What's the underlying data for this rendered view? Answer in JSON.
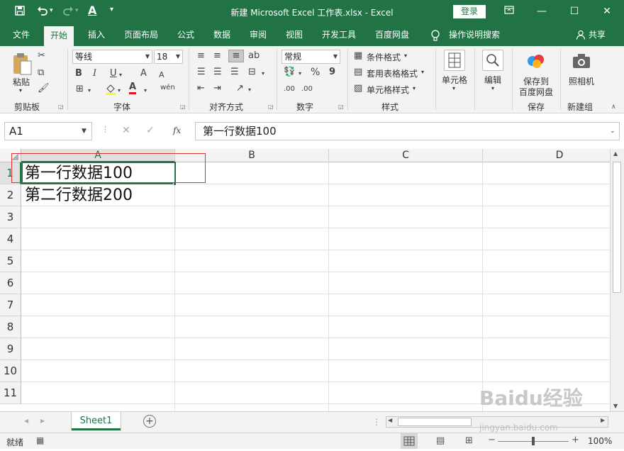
{
  "title_bar": {
    "title": "新建 Microsoft Excel 工作表.xlsx  -  Excel",
    "login_label": "登录",
    "undo_arrow": "▾",
    "redo_arrow": "▾"
  },
  "tabs": [
    {
      "label": "文件"
    },
    {
      "label": "开始"
    },
    {
      "label": "插入"
    },
    {
      "label": "页面布局"
    },
    {
      "label": "公式"
    },
    {
      "label": "数据"
    },
    {
      "label": "审阅"
    },
    {
      "label": "视图"
    },
    {
      "label": "开发工具"
    },
    {
      "label": "百度网盘"
    }
  ],
  "tell_me": "操作说明搜索",
  "share_label": "共享",
  "ribbon": {
    "clipboard": {
      "paste_label": "粘贴",
      "group_label": "剪贴板"
    },
    "font": {
      "font_name": "等线",
      "font_size": "18",
      "bold": "B",
      "italic": "I",
      "underline": "U",
      "grow": "A",
      "shrink": "A",
      "font_color": "A",
      "phonetic": "wén",
      "group_label": "字体"
    },
    "alignment": {
      "group_label": "对齐方式"
    },
    "number": {
      "format": "常规",
      "percent": "%",
      "comma": "9",
      "inc_decimal": ".00",
      "dec_decimal": ".00",
      "group_label": "数字"
    },
    "styles": {
      "conditional": "条件格式",
      "table_format": "套用表格格式",
      "cell_styles": "单元格样式",
      "group_label": "样式"
    },
    "cells": {
      "label": "单元格"
    },
    "editing": {
      "label": "编辑"
    },
    "save_baidu": {
      "line1": "保存到",
      "line2": "百度网盘",
      "group_label": "保存"
    },
    "camera": {
      "label": "照相机",
      "group_label": "新建组"
    }
  },
  "formula_bar": {
    "name_box": "A1",
    "fx": "fx",
    "content": "第一行数据100"
  },
  "columns": [
    "A",
    "B",
    "C",
    "D"
  ],
  "rows": [
    "1",
    "2",
    "3",
    "4",
    "5",
    "6",
    "7",
    "8",
    "9",
    "10",
    "11"
  ],
  "cells": {
    "A1": "第一行数据100",
    "A2": "第二行数据200"
  },
  "sheets": [
    {
      "name": "Sheet1"
    }
  ],
  "status": {
    "ready": "就绪",
    "zoom": "100%"
  },
  "watermark": {
    "text": "Baidu经验",
    "url": "jingyan.baidu.com"
  }
}
